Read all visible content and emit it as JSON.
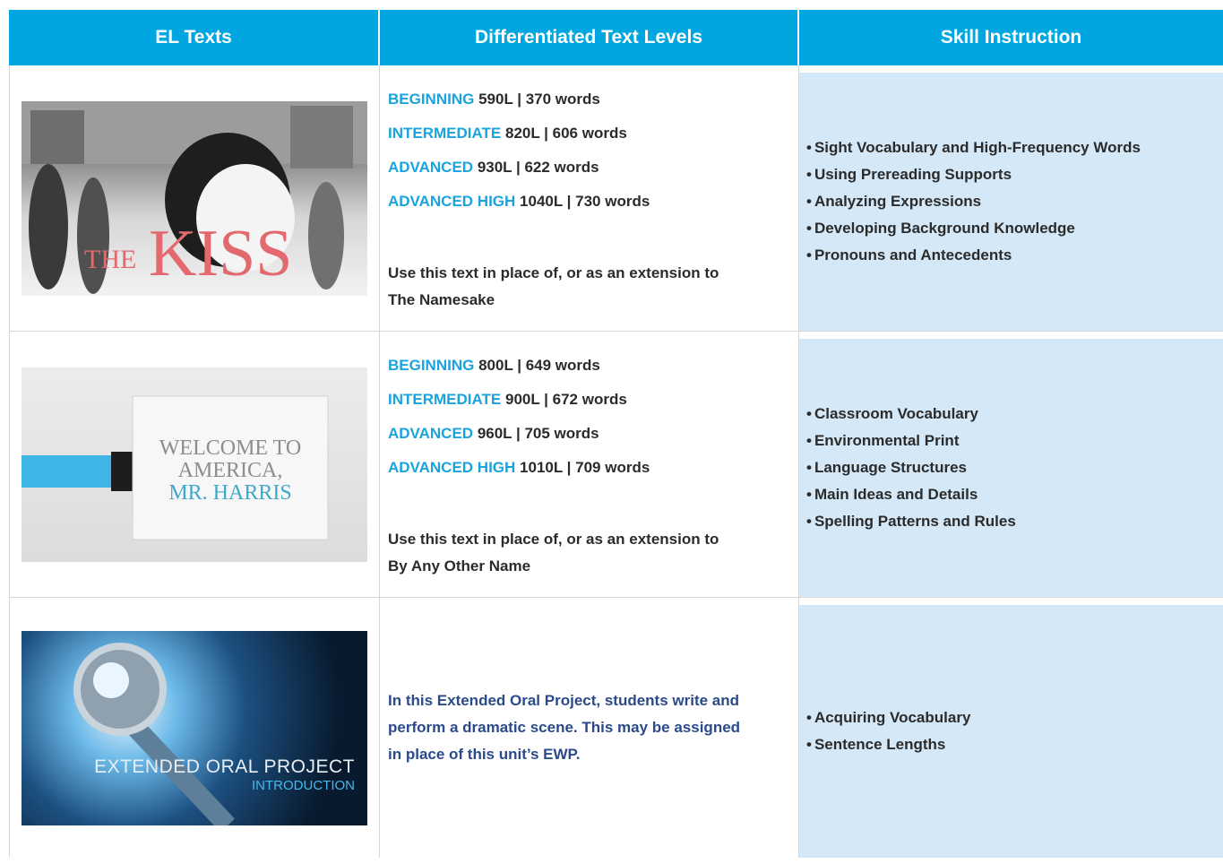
{
  "header": {
    "col1": "EL Texts",
    "col2": "Differentiated Text Levels",
    "col3": "Skill Instruction"
  },
  "rows": [
    {
      "image": {
        "title_a": "THE",
        "title_b": "KISS"
      },
      "levels": [
        {
          "name": "BEGINNING",
          "detail": "590L | 370 words"
        },
        {
          "name": "INTERMEDIATE",
          "detail": "820L | 606 words"
        },
        {
          "name": "ADVANCED",
          "detail": "930L | 622 words"
        },
        {
          "name": "ADVANCED HIGH",
          "detail": "1040L | 730 words"
        }
      ],
      "note_line1": "Use this text in place of, or as an extension to",
      "note_line2": "The Namesake",
      "skills": [
        "Sight Vocabulary and High-Frequency Words",
        "Using Prereading Supports",
        "Analyzing Expressions",
        "Developing Background Knowledge",
        "Pronouns and Antecedents"
      ]
    },
    {
      "image": {
        "line1": "WELCOME TO",
        "line2": "AMERICA,",
        "line3": "MR. HARRIS"
      },
      "levels": [
        {
          "name": "BEGINNING",
          "detail": "800L | 649 words"
        },
        {
          "name": "INTERMEDIATE",
          "detail": "900L | 672 words"
        },
        {
          "name": "ADVANCED",
          "detail": "960L | 705 words"
        },
        {
          "name": "ADVANCED HIGH",
          "detail": "1010L | 709 words"
        }
      ],
      "note_line1": "Use this text in place of, or as an extension to",
      "note_line2": "By Any Other Name",
      "skills": [
        "Classroom Vocabulary",
        "Environmental Print",
        "Language Structures",
        "Main Ideas and Details",
        "Spelling Patterns and Rules"
      ]
    },
    {
      "image": {
        "line1": "EXTENDED ORAL PROJECT",
        "line2": "INTRODUCTION"
      },
      "intro_lines": [
        "In this Extended Oral Project, students write and",
        "perform a dramatic scene. This may be assigned",
        "in place of this unit’s EWP."
      ],
      "skills": [
        "Acquiring Vocabulary",
        "Sentence Lengths"
      ]
    }
  ]
}
